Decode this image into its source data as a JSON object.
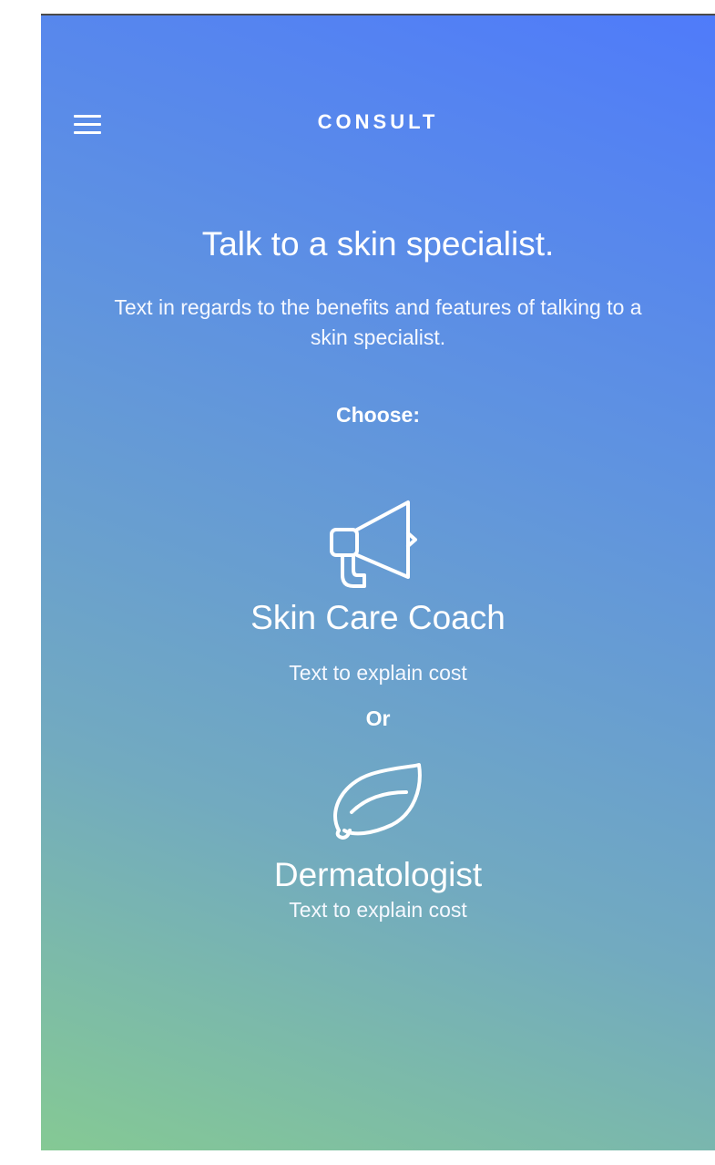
{
  "nav": {
    "title": "CONSULT",
    "menu_icon": "hamburger-menu-icon"
  },
  "intro": {
    "headline": "Talk to a skin specialist.",
    "body": "Text in regards to the benefits and features of talking to a skin specialist.",
    "choose_label": "Choose:"
  },
  "options": [
    {
      "icon": "megaphone-icon",
      "title": "Skin Care Coach",
      "cost": "Text to explain cost"
    },
    {
      "icon": "leaf-icon",
      "title": "Dermatologist",
      "cost": "Text to explain cost"
    }
  ],
  "separator": "Or",
  "colors": {
    "gradient_top": "#4f7bfa",
    "gradient_bottom": "#85c994",
    "text": "#ffffff"
  }
}
